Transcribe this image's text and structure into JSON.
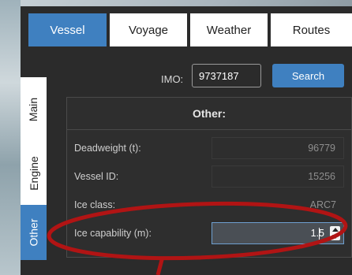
{
  "tabs": [
    {
      "label": "Vessel",
      "active": true
    },
    {
      "label": "Voyage",
      "active": false
    },
    {
      "label": "Weather",
      "active": false
    },
    {
      "label": "Routes",
      "active": false
    }
  ],
  "side_tabs": [
    {
      "label": "Main",
      "active": false
    },
    {
      "label": "Engine",
      "active": false
    },
    {
      "label": "Other",
      "active": true
    }
  ],
  "search": {
    "imo_label": "IMO:",
    "imo_value": "9737187",
    "button_label": "Search"
  },
  "card": {
    "title": "Other:",
    "rows": [
      {
        "label": "Deadweight (t):",
        "value": "96779"
      },
      {
        "label": "Vessel ID:",
        "value": "15256"
      },
      {
        "label": "Ice class:",
        "value": "ARC7"
      },
      {
        "label": "Ice capability (m):",
        "value": "1.5"
      }
    ]
  },
  "colors": {
    "accent": "#3f80c0",
    "panel_bg": "#2b2b2b",
    "annotation": "#b11414"
  }
}
